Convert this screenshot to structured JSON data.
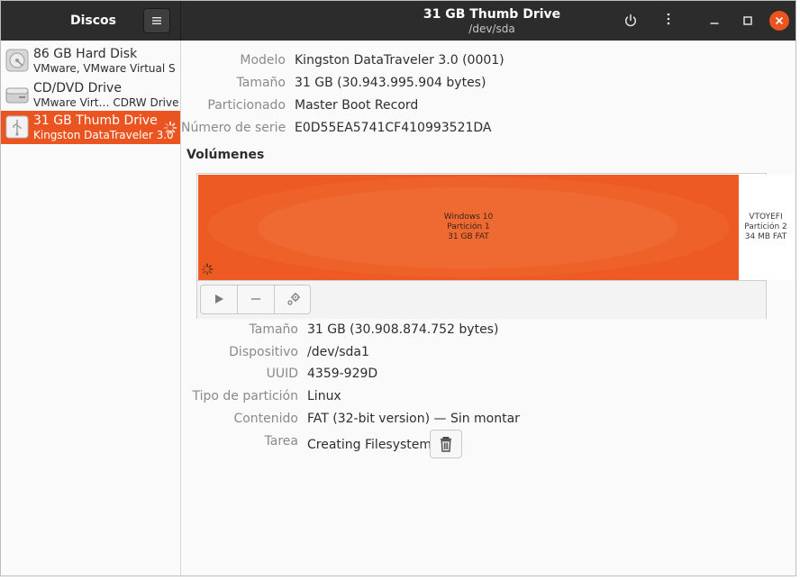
{
  "header": {
    "app_title": "Discos",
    "title": "31 GB Thumb Drive",
    "subtitle": "/dev/sda"
  },
  "sidebar": {
    "drives": [
      {
        "name": "86 GB Hard Disk",
        "sub": "VMware, VMware Virtual S",
        "icon": "hard-disk-icon"
      },
      {
        "name": "CD/DVD Drive",
        "sub": "VMware Virt… CDRW Drive",
        "icon": "optical-drive-icon"
      },
      {
        "name": "31 GB Thumb Drive",
        "sub": "Kingston DataTraveler 3.0",
        "icon": "usb-drive-icon",
        "selected": true
      }
    ]
  },
  "drive_info": {
    "model_label": "Modelo",
    "model": "Kingston DataTraveler 3.0 (0001)",
    "size_label": "Tamaño",
    "size": "31 GB (30.943.995.904 bytes)",
    "partitioning_label": "Particionado",
    "partitioning": "Master Boot Record",
    "serial_label": "Número de serie",
    "serial": "E0D55EA5741CF410993521DA"
  },
  "volumes": {
    "title": "Volúmenes",
    "partitions": [
      {
        "name": "Windows 10",
        "number": "Partición 1",
        "info": "31 GB FAT"
      },
      {
        "name": "VTOYEFI",
        "number": "Partición 2",
        "info": "34 MB FAT"
      }
    ]
  },
  "partition_info": {
    "size_label": "Tamaño",
    "size": "31 GB (30.908.874.752 bytes)",
    "device_label": "Dispositivo",
    "device": "/dev/sda1",
    "uuid_label": "UUID",
    "uuid": "4359-929D",
    "type_label": "Tipo de partición",
    "type": "Linux",
    "contents_label": "Contenido",
    "contents": "FAT (32-bit version) — Sin montar",
    "task_label": "Tarea",
    "task": "Creating Filesystem"
  },
  "colors": {
    "accent": "#e95420",
    "headerbar": "#2c2c2c"
  }
}
